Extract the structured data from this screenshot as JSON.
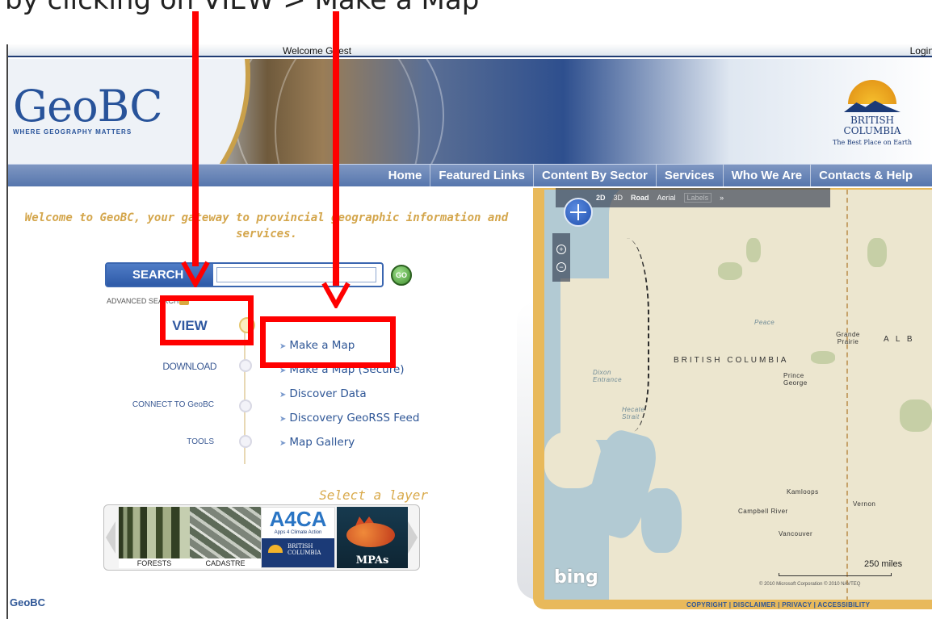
{
  "caption": "by clicking on VIEW > Make a Map",
  "header": {
    "welcome": "Welcome Guest",
    "login": "Login",
    "logo_word": "GeoBC",
    "logo_tagline": "WHERE GEOGRAPHY MATTERS",
    "bc_name_line1": "BRITISH",
    "bc_name_line2": "COLUMBIA",
    "bc_motto": "The Best Place on Earth"
  },
  "nav": {
    "items": [
      "Home",
      "Featured Links",
      "Content By Sector",
      "Services",
      "Who We Are",
      "Contacts & Help"
    ]
  },
  "welcome_text": "Welcome to GeoBC, your gateway to provincial geographic information and services.",
  "search": {
    "label": "SEARCH",
    "value": "",
    "go": "GO",
    "advanced": "ADVANCED SEARCH"
  },
  "side_menu": {
    "view": "VIEW",
    "download": "DOWNLOAD",
    "connect": "CONNECT TO GeoBC",
    "tools": "TOOLS"
  },
  "view_submenu": [
    "Make a Map",
    "Make a Map (Secure)",
    "Discover Data",
    "Discovery GeoRSS Feed",
    "Map Gallery"
  ],
  "layers": {
    "title": "Select a layer",
    "tiles": [
      "FORESTS",
      "CADASTRE",
      "A4CA",
      "MPAs"
    ],
    "a4ca_sub": "Apps 4 Climate Action",
    "a4ca_bc": "BRITISH COLUMBIA"
  },
  "map": {
    "toolbar": [
      "2D",
      "3D",
      "Road",
      "Aerial",
      "Labels",
      "»"
    ],
    "labels": {
      "province": "BRITISH COLUMBIA",
      "alberta": "A L B",
      "peace": "Peace",
      "grande_prairie": "Grande Prairie",
      "prince_george": "Prince George",
      "dixon": "Dixon Entrance",
      "hecate": "Hecate Strait",
      "kamloops": "Kamloops",
      "campbell": "Campbell River",
      "vernon": "Vernon",
      "vancouver": "Vancouver"
    },
    "scale": "250 miles",
    "brand": "bing",
    "copyright": "© 2010 Microsoft Corporation  © 2010 NAVTEQ"
  },
  "footer": {
    "left": "GeoBC",
    "right": "COPYRIGHT | DISCLAIMER | PRIVACY | ACCESSIBILITY"
  },
  "colors": {
    "annotation": "#ff0000",
    "brand_blue": "#2e5696",
    "gold": "#e8b95b"
  }
}
